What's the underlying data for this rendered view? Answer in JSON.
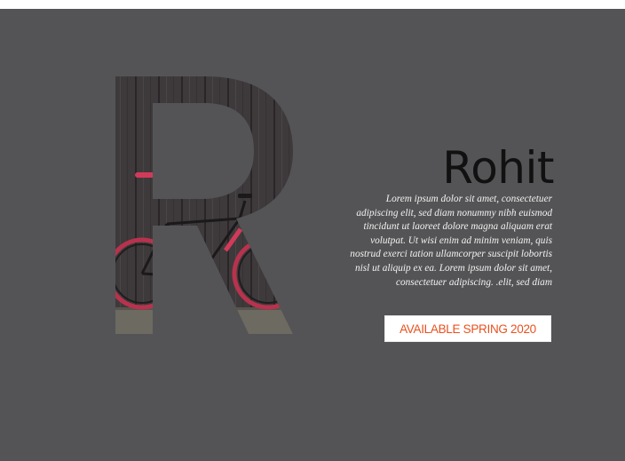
{
  "hero": {
    "letter": "R",
    "title": "Rohit",
    "description": "Lorem ipsum dolor sit amet, consectetuer adipiscing elit, sed diam nonummy nibh euismod tincidunt ut laoreet dolore magna aliquam erat volutpat. Ut wisi enim ad minim veniam, quis nostrud exerci tation ullamcorper suscipit lobortis nisl ut aliquip ex ea. Lorem ipsum dolor sit amet, consectetuer adipiscing. .elit, sed diam",
    "cta_label": "AVAILABLE SPRING 2020"
  },
  "colors": {
    "page_background": "#545456",
    "accent": "#e8511e",
    "title": "#111111",
    "body_text": "#f2f2f2"
  }
}
